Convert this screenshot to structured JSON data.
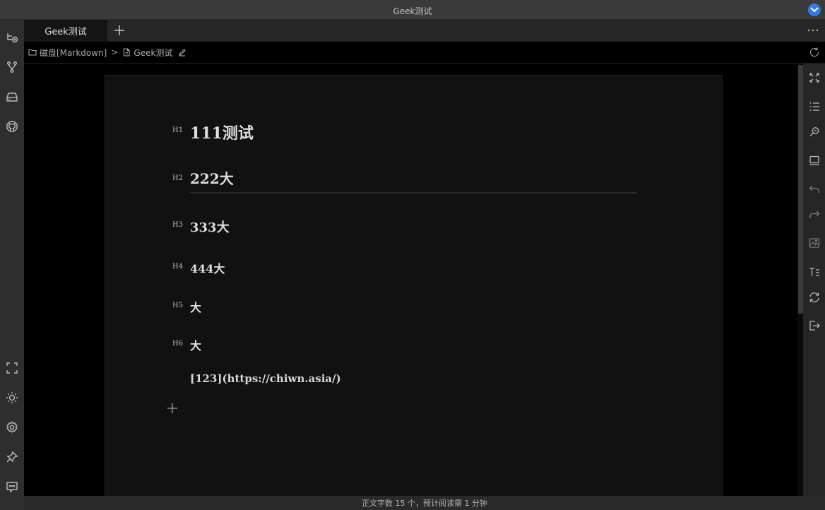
{
  "window": {
    "title": "Geek测试"
  },
  "tabs": [
    {
      "label": "Geek测试",
      "active": true
    }
  ],
  "breadcrumb": {
    "folder": "磁盘[Markdown]",
    "separator": ">",
    "file": "Geek测试"
  },
  "document": {
    "headings": [
      {
        "level_label": "H1",
        "text": "111测试"
      },
      {
        "level_label": "H2",
        "text": "222大"
      },
      {
        "level_label": "H3",
        "text": "333大"
      },
      {
        "level_label": "H4",
        "text": "444大"
      },
      {
        "level_label": "H5",
        "text": "大"
      },
      {
        "level_label": "H6",
        "text": "大"
      }
    ],
    "paragraph": "[123](https://chiwn.asia/)"
  },
  "status": {
    "text": "正文字数 15 个，预计阅读需 1 分钟"
  },
  "left_icons": [
    "new-connection-icon",
    "branch-icon",
    "drive-icon",
    "github-icon",
    "fullscreen-icon",
    "theme-icon",
    "settings-icon",
    "pin-icon",
    "feedback-icon"
  ],
  "right_icons": [
    "expand-icon",
    "outline-icon",
    "search-replace-icon",
    "preview-icon",
    "undo-icon",
    "redo-icon",
    "image-icon",
    "text-format-icon",
    "sync-icon",
    "export-icon"
  ],
  "colors": {
    "accent": "#2f7ae5",
    "page_bg": "#111111",
    "sidebar_bg": "#2e2e2e"
  }
}
